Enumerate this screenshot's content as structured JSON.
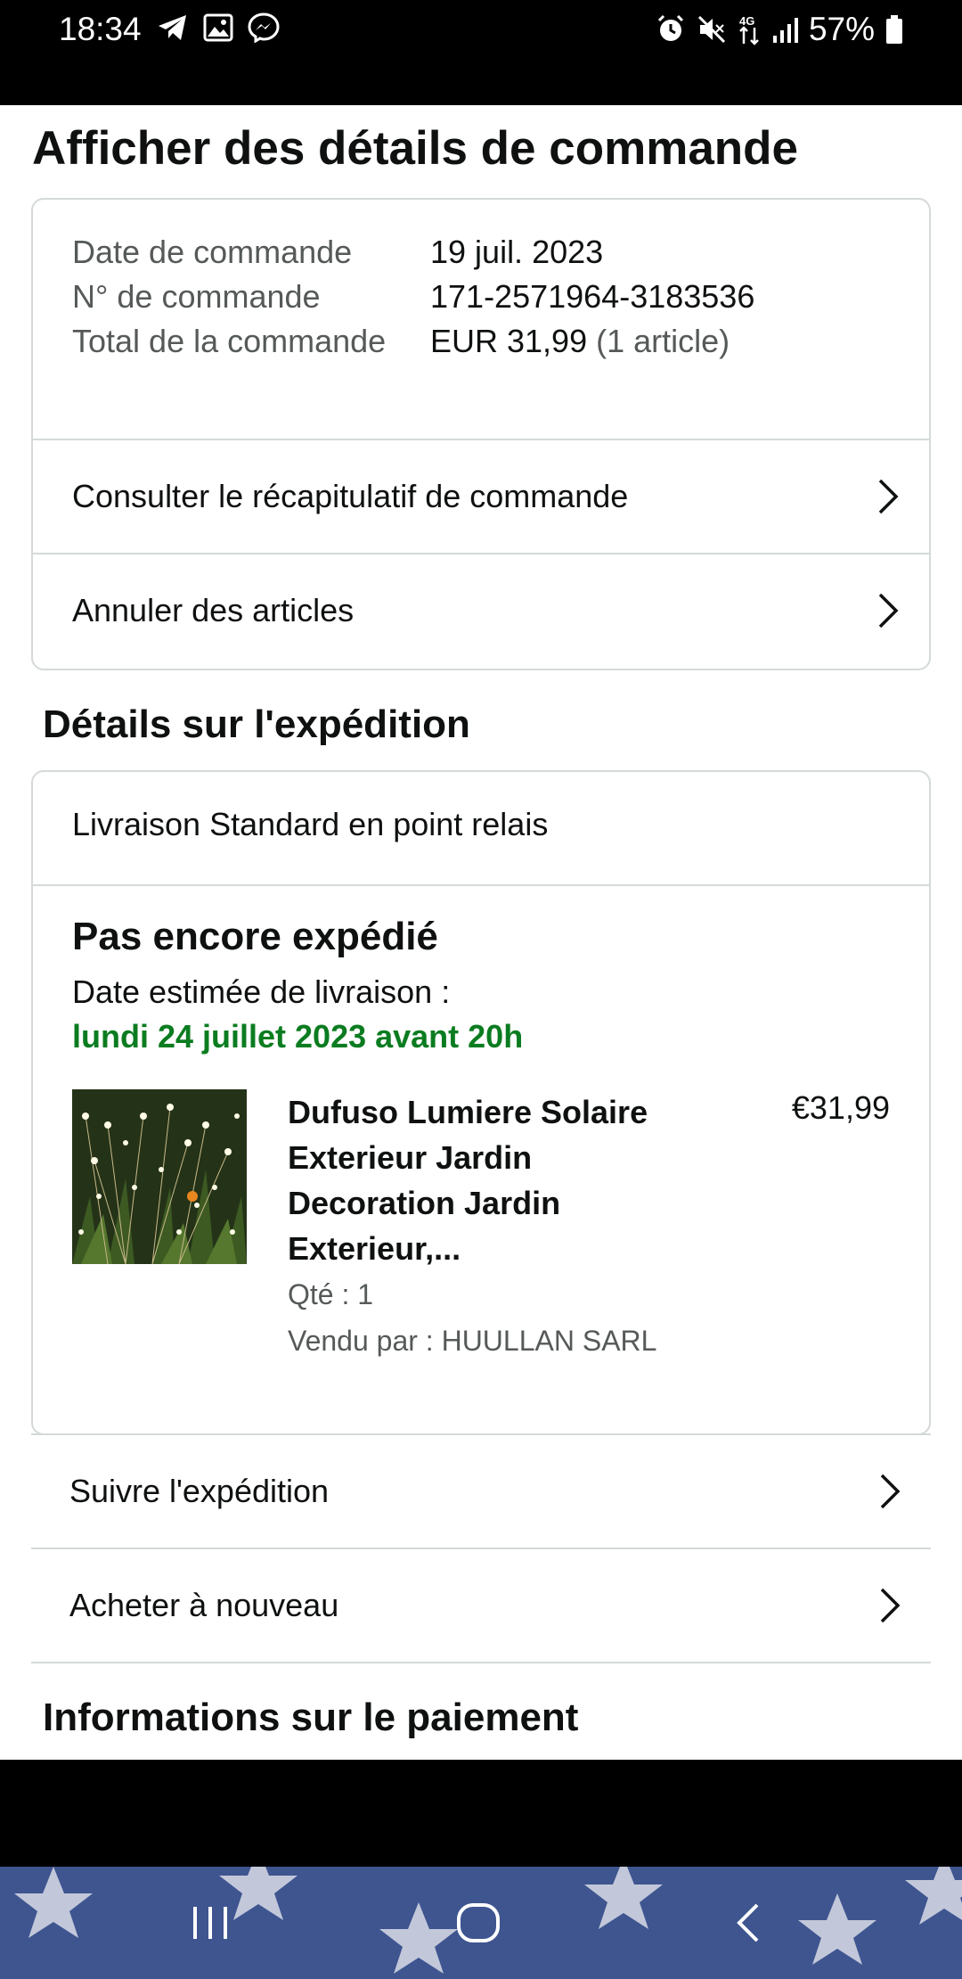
{
  "status_bar": {
    "time": "18:34",
    "battery": "57%",
    "left_icons": [
      "telegram-icon",
      "gallery-icon",
      "messenger-icon"
    ],
    "right_icons": [
      "alarm-icon",
      "mute-icon",
      "4g-data-icon",
      "signal-icon",
      "battery-icon"
    ]
  },
  "page": {
    "title": "Afficher des détails de commande"
  },
  "order_summary": {
    "date_label": "Date de commande",
    "date_value": "19 juil. 2023",
    "number_label": "N° de commande",
    "number_value": "171-2571964-3183536",
    "total_label": "Total de la commande",
    "total_value": "EUR 31,99",
    "total_items": "(1 article)",
    "recap_link": "Consulter le récapitulatif de commande",
    "cancel_link": "Annuler des articles"
  },
  "shipping": {
    "section_title": "Détails sur l'expédition",
    "method": "Livraison Standard en point relais",
    "status": "Pas encore expédié",
    "eta_label": "Date estimée de livraison :",
    "eta_date": "lundi 24 juillet 2023 avant 20h",
    "product": {
      "title": "Dufuso Lumiere Solaire Exterieur Jardin Decoration Jardin Exterieur,...",
      "price": "€31,99",
      "qty": "Qté : 1",
      "seller": "Vendu par : HUULLAN SARL"
    },
    "track_link": "Suivre l'expédition",
    "buy_again_link": "Acheter à nouveau"
  },
  "payment": {
    "section_title": "Informations sur le paiement"
  },
  "nav_bar": {
    "buttons": [
      "recents-icon",
      "home-icon",
      "back-icon"
    ]
  },
  "colors": {
    "eta_green": "#0b7c20",
    "border": "#d5d9d9",
    "muted_text": "#565959"
  }
}
